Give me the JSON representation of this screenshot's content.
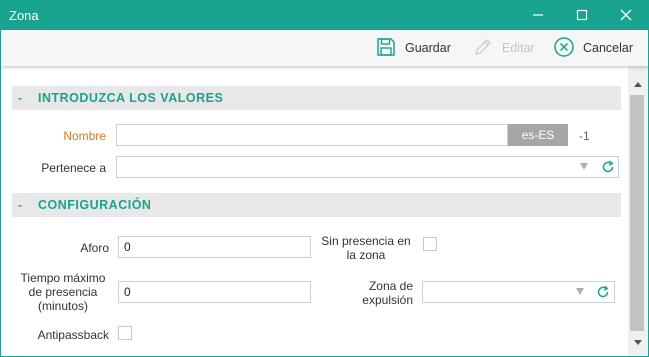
{
  "window": {
    "title": "Zona",
    "accent_color": "#17a390",
    "controls": [
      "minimize-icon",
      "maximize-icon",
      "close-icon"
    ]
  },
  "toolbar": {
    "save_label": "Guardar",
    "edit_label": "Editar",
    "cancel_label": "Cancelar"
  },
  "sections": {
    "values": {
      "collapse": "-",
      "title": "INTRODUZCA LOS VALORES"
    },
    "config": {
      "collapse": "-",
      "title": "CONFIGURACIÓN"
    }
  },
  "fields": {
    "nombre": {
      "label": "Nombre",
      "value": "",
      "lang": "es-ES",
      "suffix": "-1"
    },
    "pertenece": {
      "label": "Pertenece a",
      "value": ""
    },
    "aforo": {
      "label": "Aforo",
      "value": "0"
    },
    "sin_presencia": {
      "label_line1": "Sin presencia en",
      "label_line2": "la zona",
      "checked": false
    },
    "tiempo": {
      "label_line1": "Tiempo máximo",
      "label_line2": "de presencia",
      "label_line3": "(minutos)",
      "value": "0"
    },
    "zona_expulsion": {
      "label_line1": "Zona de",
      "label_line2": "expulsión",
      "value": ""
    },
    "antipassback": {
      "label": "Antipassback",
      "checked": false
    }
  }
}
